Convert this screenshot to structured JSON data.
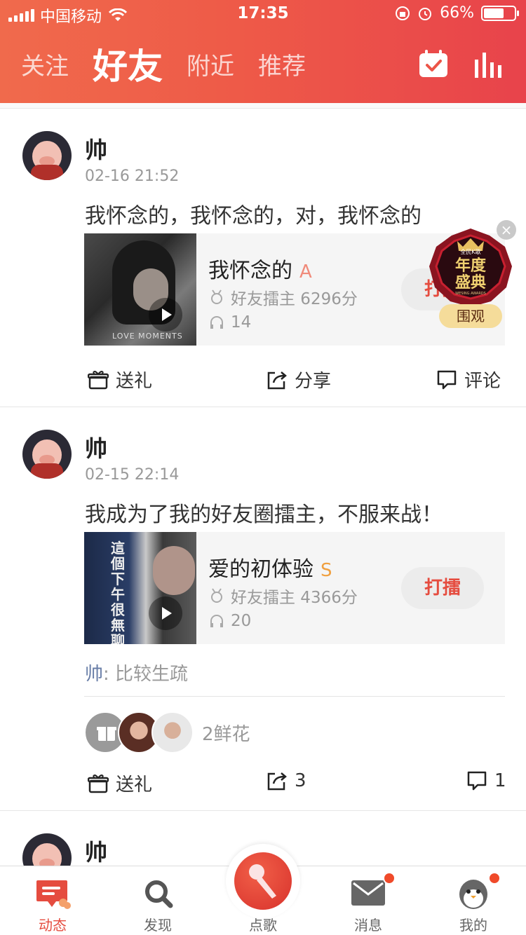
{
  "status_bar": {
    "carrier": "中国移动",
    "time": "17:35",
    "battery": "66%"
  },
  "header": {
    "tabs": [
      {
        "label": "关注",
        "active": false
      },
      {
        "label": "好友",
        "active": true
      },
      {
        "label": "附近",
        "active": false
      },
      {
        "label": "推荐",
        "active": false
      }
    ],
    "icons": [
      "calendar-check-icon",
      "bars-chart-icon"
    ]
  },
  "posts": [
    {
      "user": "帅",
      "time": "02-16 21:52",
      "text": "我怀念的，我怀念的，对，我怀念的",
      "song": {
        "title": "我怀念的",
        "grade": "A",
        "grade_color": "#f08a7a",
        "rank": "好友擂主 6296分",
        "plays": "14",
        "action": "打擂",
        "cover_text": "LOVE MOMENTS"
      },
      "actions": {
        "gift": "送礼",
        "share": "分享",
        "comment": "评论"
      }
    },
    {
      "user": "帅",
      "time": "02-15 22:14",
      "text": "我成为了我的好友圈擂主，不服来战！",
      "song": {
        "title": "爱的初体验",
        "grade": "S",
        "grade_color": "#f0a040",
        "rank": "好友擂主 4366分",
        "plays": "20",
        "action": "打擂",
        "cover_text": "這個下午很無聊"
      },
      "comment": {
        "who": "帅",
        "sep": ": ",
        "text": "比较生疏"
      },
      "gifts": {
        "label": "2鲜花"
      },
      "actions": {
        "gift": "送礼",
        "share": "3",
        "comment": "1"
      }
    },
    {
      "user": "帅"
    }
  ],
  "promo": {
    "title": "年度盛典",
    "button": "围观",
    "close": "×",
    "brand": "全民K歌",
    "subtitle": "WESING AWARDS"
  },
  "bottom_nav": [
    {
      "label": "动态",
      "active": true
    },
    {
      "label": "发现",
      "active": false
    },
    {
      "label": "点歌",
      "active": false
    },
    {
      "label": "消息",
      "active": false,
      "badge": true
    },
    {
      "label": "我的",
      "active": false,
      "badge": true
    }
  ],
  "colors": {
    "accent": "#e54c3f",
    "header_start": "#f06a4c",
    "header_end": "#e8434b"
  }
}
